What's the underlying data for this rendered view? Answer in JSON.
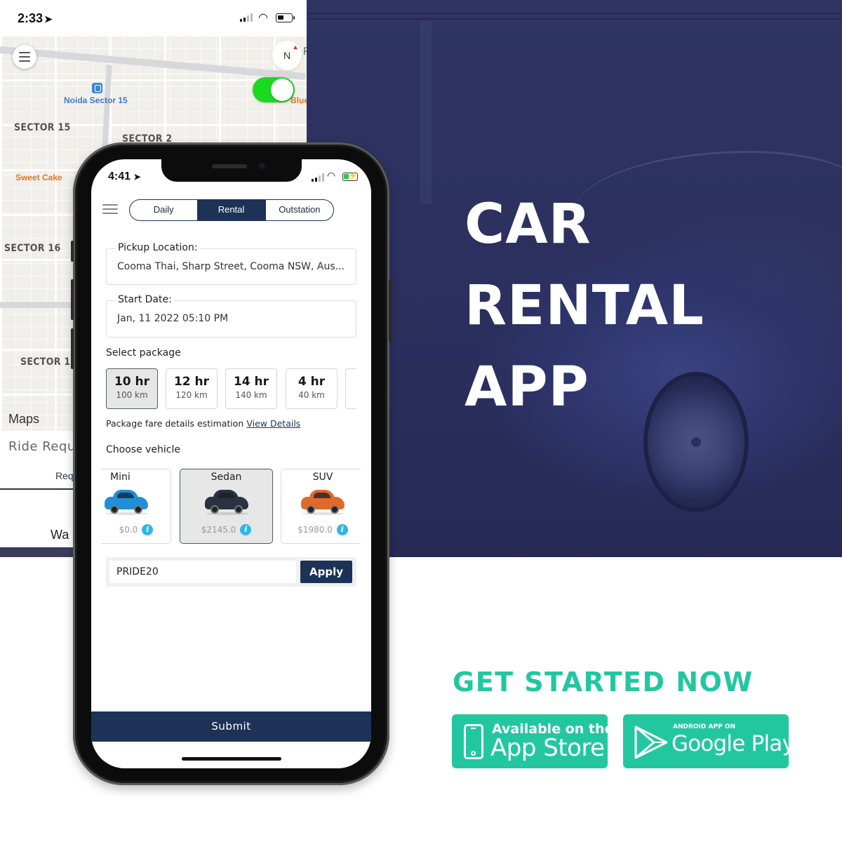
{
  "hero": {
    "title_lines": [
      "CAR",
      "RENTAL",
      "APP"
    ]
  },
  "back_screen": {
    "status": {
      "time": "2:33",
      "location_arrow": "location-arrow-icon"
    },
    "map": {
      "labels": {
        "noida_sector_15": "Noida Sector 15",
        "sector_15": "SECTOR 15",
        "sector_2": "SECTOR 2",
        "sweet_cake": "Sweet Cake",
        "sector_16": "SECTOR 16",
        "sector_17": "SECTOR 17",
        "blue_poi": "Blue",
        "r_poi": "R"
      },
      "compass_label": "N",
      "toggle_on": true,
      "maps_brand": "Maps"
    },
    "ride_request_label": "Ride Requ",
    "request_link": "Req",
    "waiting_text": "Wa"
  },
  "front_screen": {
    "status": {
      "time": "4:41"
    },
    "tabs": [
      {
        "label": "Daily",
        "active": false
      },
      {
        "label": "Rental",
        "active": true
      },
      {
        "label": "Outstation",
        "active": false
      }
    ],
    "pickup": {
      "label": "Pickup Location:",
      "value": "Cooma Thai, Sharp Street, Cooma NSW, Aus..."
    },
    "start_date": {
      "label": "Start Date:",
      "value": "Jan, 11 2022 05:10 PM"
    },
    "select_package_label": "Select package",
    "packages": [
      {
        "hours": "10 hr",
        "distance": "100 km",
        "selected": true
      },
      {
        "hours": "12 hr",
        "distance": "120 km",
        "selected": false
      },
      {
        "hours": "14 hr",
        "distance": "140 km",
        "selected": false
      },
      {
        "hours": "4 hr",
        "distance": "40 km",
        "selected": false
      }
    ],
    "fare_text": "Package fare details estimation",
    "fare_link": "View Details",
    "choose_vehicle_label": "Choose vehicle",
    "vehicles": [
      {
        "name": "Mini",
        "price": "$0.0",
        "color": "#1e8fd8",
        "selected": false
      },
      {
        "name": "Sedan",
        "price": "$2145.0",
        "color": "#2a3140",
        "selected": true
      },
      {
        "name": "SUV",
        "price": "$1980.0",
        "color": "#e06a2a",
        "selected": false
      }
    ],
    "promo": {
      "value": "PRIDE20",
      "apply_label": "Apply"
    },
    "submit_label": "Submit"
  },
  "cta": {
    "title": "GET STARTED NOW",
    "app_store": {
      "small": "Available on the",
      "big": "App Store"
    },
    "google_play": {
      "small": "ANDROID APP ON",
      "big": "Google Play"
    }
  },
  "colors": {
    "navy": "#1c3256",
    "teal": "#22c7a0",
    "hero_overlay": "#2c3160",
    "toggle_green": "#1bd91f",
    "info_blue": "#2fb6e8"
  }
}
